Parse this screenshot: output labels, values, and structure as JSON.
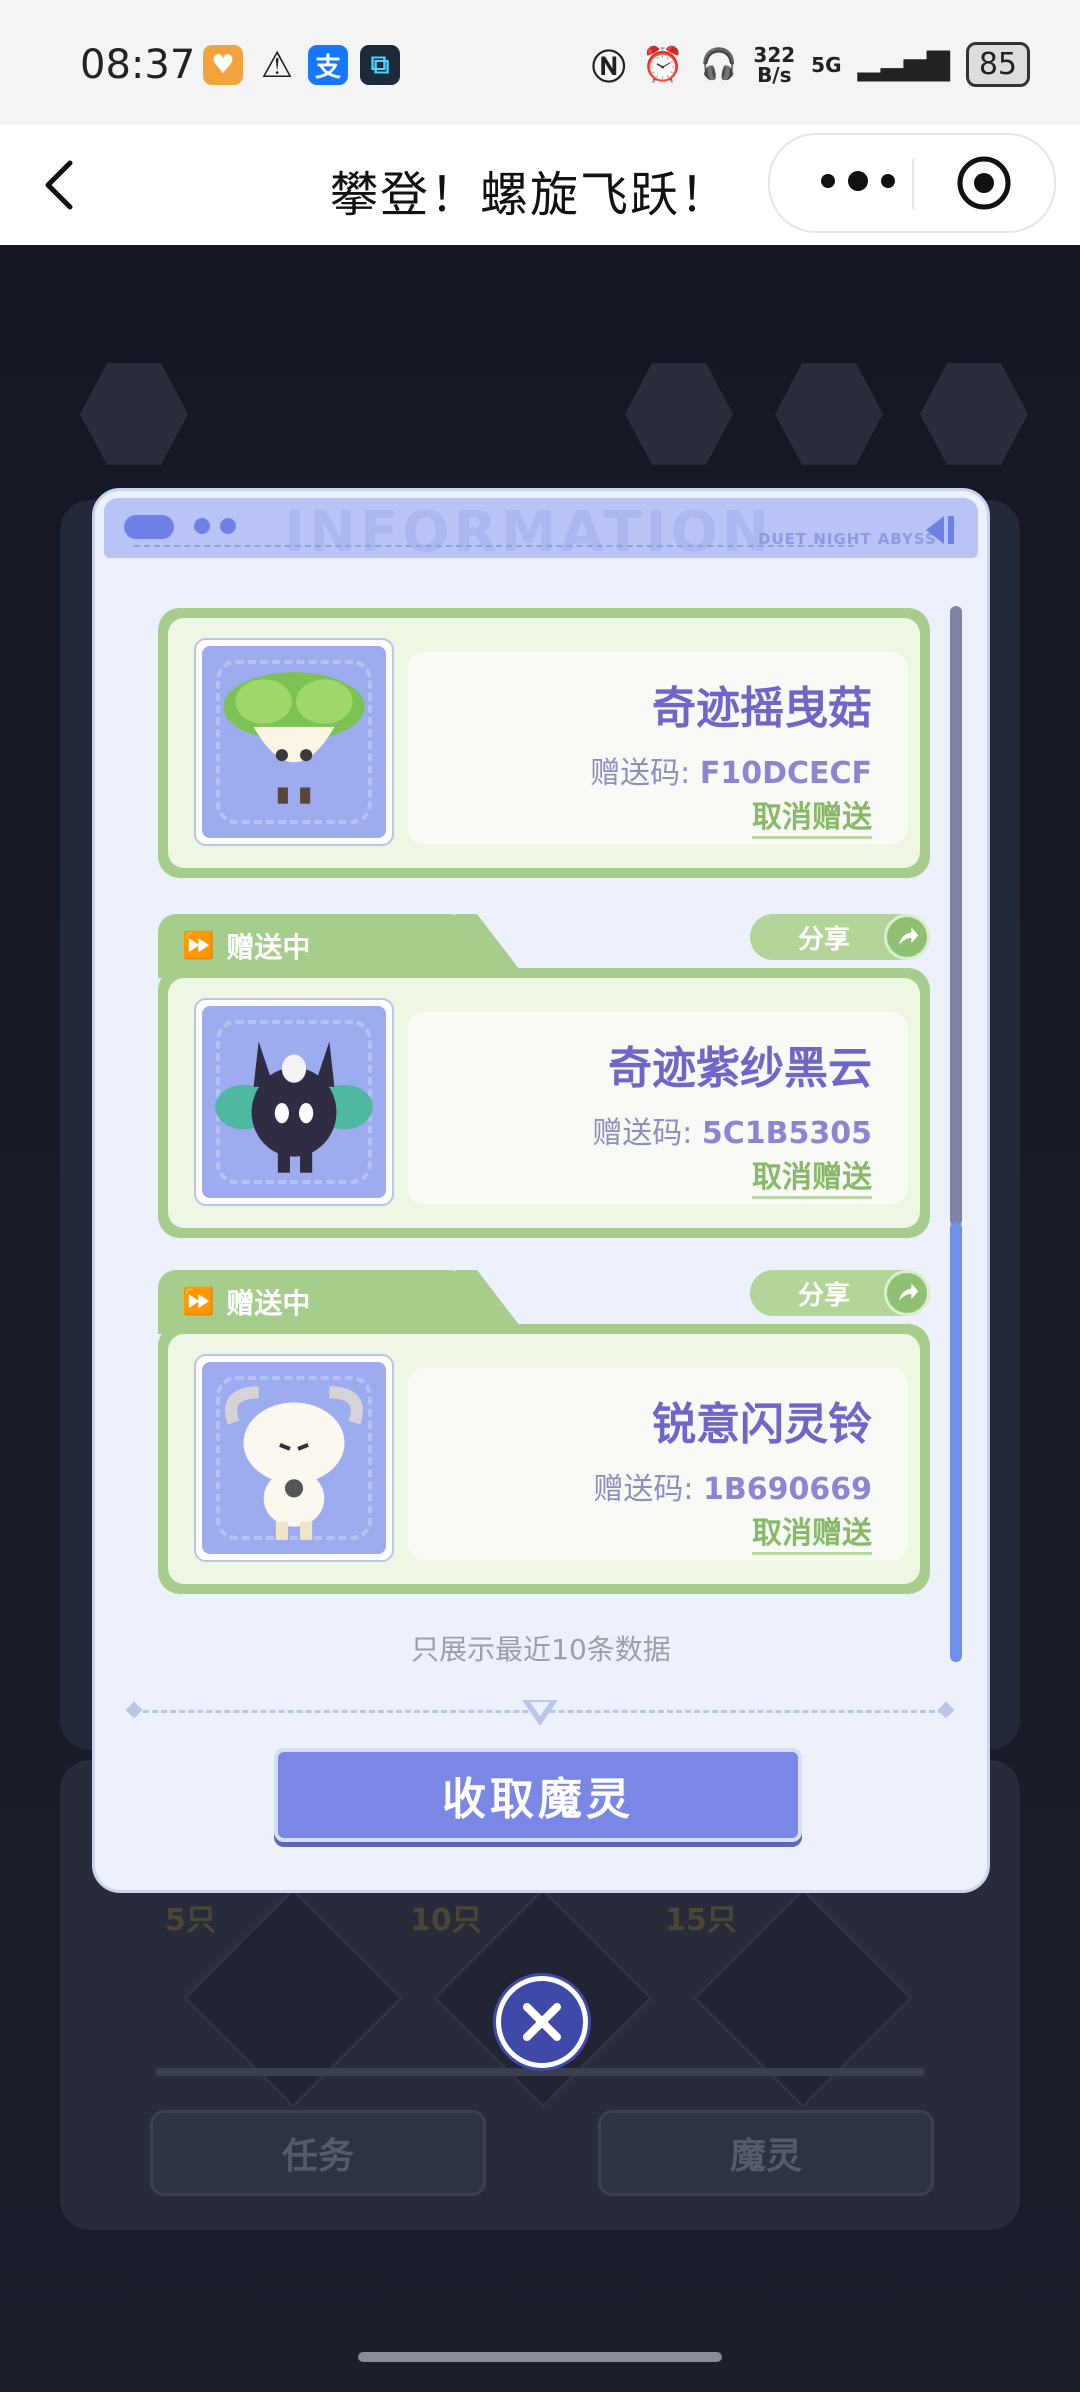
{
  "status_bar": {
    "time": "08:37",
    "net_speed_value": "322",
    "net_speed_unit": "B/s",
    "network": "5G",
    "battery": "85",
    "left_icons": [
      "health-app-icon",
      "warning-icon",
      "alipay-icon",
      "app-icon"
    ],
    "right_icons": [
      "nfc-icon",
      "alarm-icon",
      "headphone-icon",
      "signal-icon",
      "battery-icon"
    ]
  },
  "titlebar": {
    "title": "攀登！螺旋飞跃！"
  },
  "background": {
    "tasks_label": "任务",
    "spirits_label": "魔灵",
    "milestones": [
      "5只",
      "10只",
      "15只"
    ]
  },
  "modal": {
    "header_watermark": "INFORMATION",
    "header_brand": "DUET NIGHT ABYSS",
    "gifts": [
      {
        "status": "",
        "share_label": "",
        "name": "奇迹摇曳菇",
        "code_label": "赠送码: ",
        "code": "F10DCECF",
        "cancel_label": "取消赠送"
      },
      {
        "status": "赠送中",
        "share_label": "分享",
        "name": "奇迹紫纱黑云",
        "code_label": "赠送码: ",
        "code": "5C1B5305",
        "cancel_label": "取消赠送"
      },
      {
        "status": "赠送中",
        "share_label": "分享",
        "name": "锐意闪灵铃",
        "code_label": "赠送码: ",
        "code": "1B690669",
        "cancel_label": "取消赠送"
      }
    ],
    "note": "只展示最近10条数据",
    "collect_button": "收取魔灵"
  },
  "colors": {
    "accent": "#7a87e4",
    "card_green": "#a7cd8c",
    "name_purple": "#6f66c9"
  }
}
